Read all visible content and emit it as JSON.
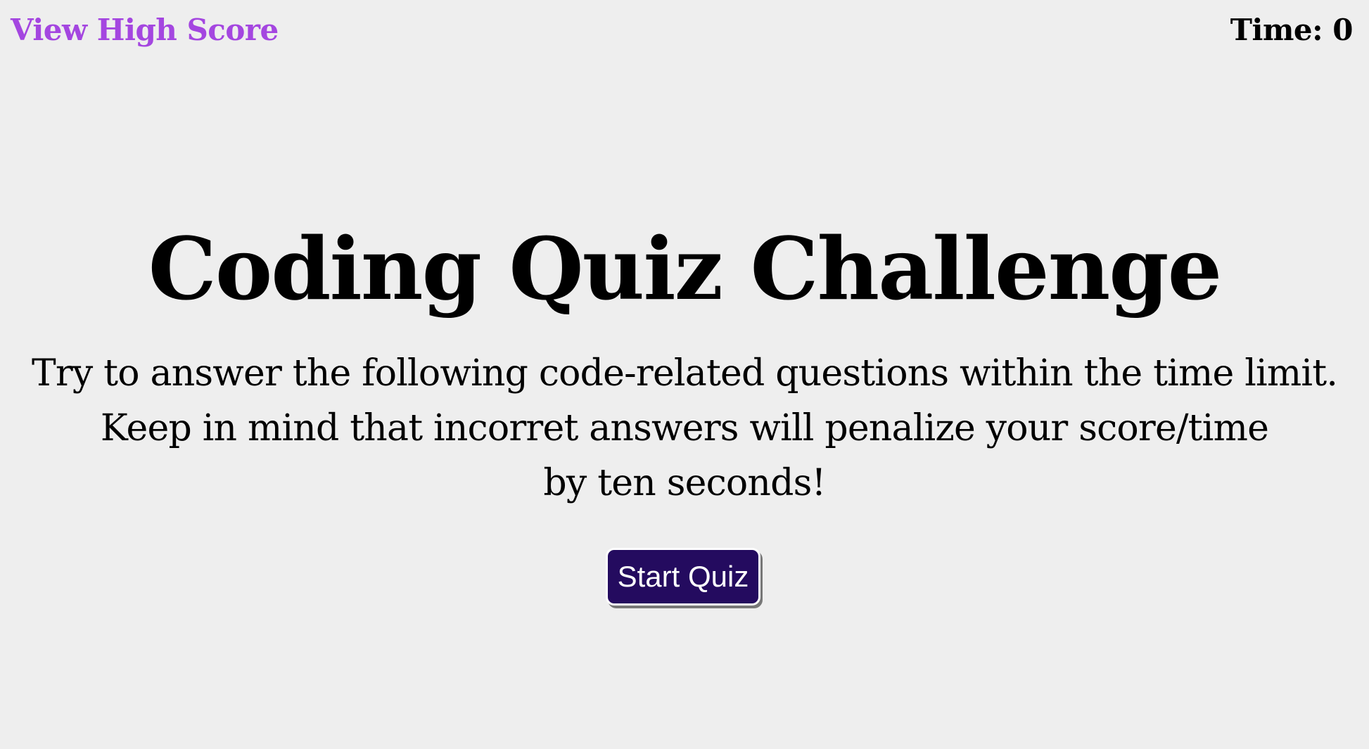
{
  "header": {
    "high_score_link": "View High Score",
    "timer_text": "Time: 0"
  },
  "main": {
    "title": "Coding Quiz Challenge",
    "intro_lines": [
      "Try to answer the following code-related questions within the time limit.",
      "Keep in mind that incorret answers will penalize your score/time",
      "by ten seconds!"
    ],
    "start_button_label": "Start Quiz"
  },
  "colors": {
    "background": "#eeeeee",
    "link": "#a446e0",
    "button_bg": "#240b5f",
    "button_text": "#ffffff"
  }
}
